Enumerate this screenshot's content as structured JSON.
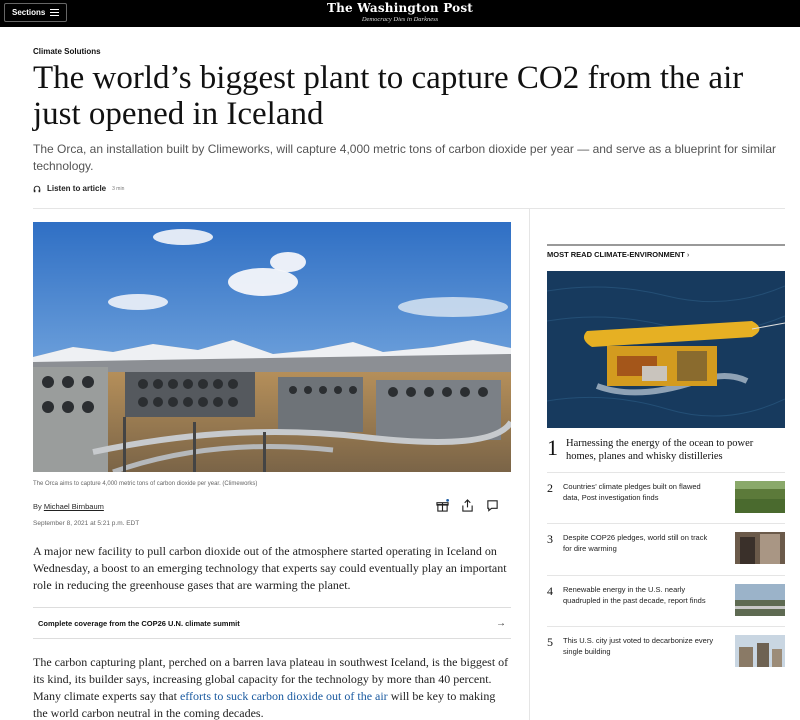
{
  "header": {
    "sections_label": "Sections",
    "logo": "The Washington Post",
    "tagline": "Democracy Dies in Darkness"
  },
  "article": {
    "kicker": "Climate Solutions",
    "headline": "The world’s biggest plant to capture CO2 from the air just opened in Iceland",
    "dek": "The Orca, an installation built by Climeworks, will capture 4,000 metric tons of carbon dioxide per year — and serve as a blueprint for similar technology.",
    "listen_label": "Listen to article",
    "listen_duration": "3 min",
    "caption": "The Orca aims to capture 4,000 metric tons of carbon dioxide per year. (Climeworks)",
    "byline_prefix": "By ",
    "author": "Michael Birnbaum",
    "date": "September 8, 2021 at 5:21 p.m. EDT",
    "para1": "A major new facility to pull carbon dioxide out of the atmosphere started operating in Iceland on Wednesday, a boost to an emerging technology that experts say could eventually play an important role in reducing the greenhouse gases that are warming the planet.",
    "coverage_label": "Complete coverage from the COP26 U.N. climate summit",
    "para2_a": "The carbon capturing plant, perched on a barren lava plateau in southwest Iceland, is the biggest of its kind, its builder says, increasing global capacity for the technology by more than 40 percent. Many climate experts say that ",
    "para2_link": "efforts to suck carbon dioxide out of the air",
    "para2_b": " will be key to making the world carbon neutral in the coming decades."
  },
  "sidebar": {
    "heading": "MOST READ CLIMATE-ENVIRONMENT",
    "items": [
      {
        "rank": "1",
        "title": "Harnessing the energy of the ocean to power homes, planes and whisky distilleries"
      },
      {
        "rank": "2",
        "title": "Countries’ climate pledges built on flawed data, Post investigation finds"
      },
      {
        "rank": "3",
        "title": "Despite COP26 pledges, world still on track for dire warming"
      },
      {
        "rank": "4",
        "title": "Renewable energy in the U.S. nearly quadrupled in the past decade, report finds"
      },
      {
        "rank": "5",
        "title": "This U.S. city just voted to decarbonize every single building"
      }
    ]
  },
  "icons": [
    "headphones-icon",
    "gift-icon",
    "share-icon",
    "comment-icon",
    "chevron-right-icon",
    "arrow-right-icon",
    "menu-icon"
  ]
}
